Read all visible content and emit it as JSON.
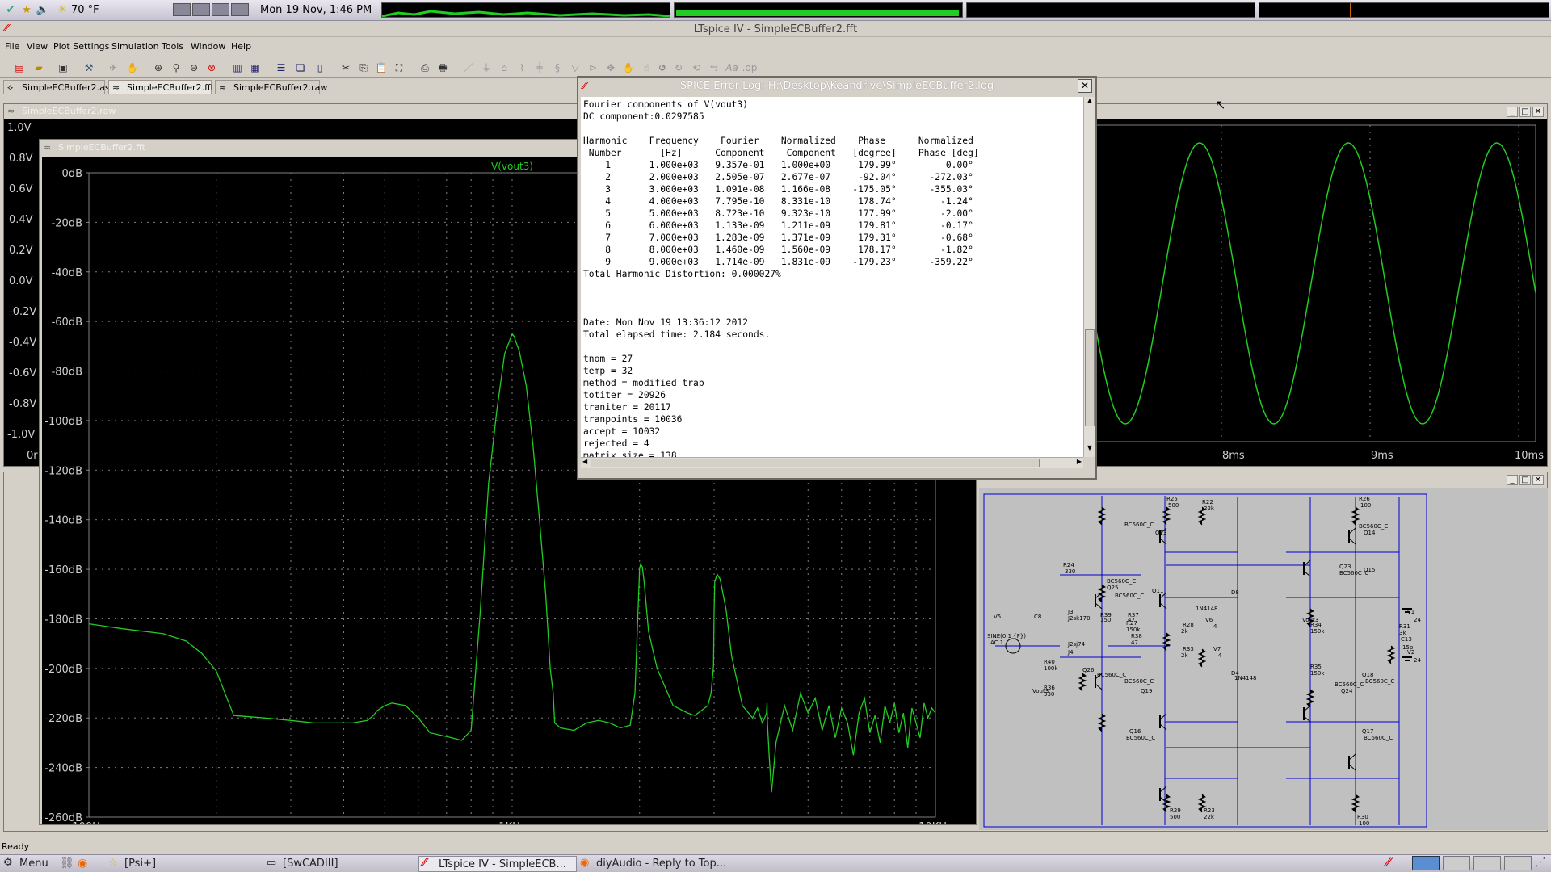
{
  "system_panel": {
    "weather": "70 °F",
    "clock": "Mon 19 Nov,  1:46 PM"
  },
  "window": {
    "title": "LTspice IV - SimpleECBuffer2.fft"
  },
  "menu": [
    "File",
    "View",
    "Plot Settings",
    "Simulation",
    "Tools",
    "Window",
    "Help"
  ],
  "tabs": [
    {
      "label": "SimpleECBuffer2.asc",
      "active": false
    },
    {
      "label": "SimpleECBuffer2.fft",
      "active": true
    },
    {
      "label": "SimpleECBuffer2.raw",
      "active": false
    }
  ],
  "raw_window": {
    "title": "SimpleECBuffer2.raw",
    "y_ticks": [
      "1.0V",
      "0.8V",
      "0.6V",
      "0.4V",
      "0.2V",
      "0.0V",
      "-0.2V",
      "-0.4V",
      "-0.6V",
      "-0.8V",
      "-1.0V"
    ],
    "x_ticks": [
      "8ms",
      "9ms",
      "10ms"
    ],
    "x_partial_label": "0r"
  },
  "fft_window": {
    "title": "SimpleECBuffer2.fft",
    "trace_label": "V(vout3)",
    "colors": {
      "trace": "#22cc22",
      "grid": "#808080",
      "background": "#000000"
    }
  },
  "chart_data": {
    "type": "line",
    "title": "",
    "series": [
      {
        "name": "V(vout3)"
      }
    ],
    "xlabel": "",
    "ylabel": "",
    "x_scale": "log",
    "xlim": [
      100,
      10000
    ],
    "ylim": [
      -260,
      0
    ],
    "y_ticks": [
      "0dB",
      "-20dB",
      "-40dB",
      "-60dB",
      "-80dB",
      "-100dB",
      "-120dB",
      "-140dB",
      "-160dB",
      "-180dB",
      "-200dB",
      "-220dB",
      "-240dB",
      "-260dB"
    ],
    "x_ticks": [
      "100Hz",
      "1KHz",
      "10KHz"
    ],
    "x": [
      100,
      120,
      150,
      170,
      185,
      200,
      220,
      260,
      300,
      340,
      380,
      420,
      455,
      470,
      480,
      500,
      520,
      560,
      600,
      640,
      680,
      720,
      760,
      800,
      840,
      880,
      920,
      960,
      990,
      1000,
      1010,
      1040,
      1080,
      1120,
      1160,
      1200,
      1230,
      1250,
      1260,
      1300,
      1400,
      1500,
      1600,
      1700,
      1800,
      1900,
      1950,
      1970,
      1990,
      2000,
      2010,
      2030,
      2050,
      2100,
      2200,
      2400,
      2600,
      2700,
      2800,
      2900,
      2950,
      2990,
      3000,
      3010,
      3050,
      3100,
      3200,
      3300,
      3500,
      3700,
      3800,
      3900,
      3950,
      3990,
      4000,
      4010,
      4050,
      4100,
      4200,
      4400,
      4600,
      4800,
      5000,
      5200,
      5400,
      5600,
      5800,
      6000,
      6200,
      6400,
      6600,
      6800,
      7000,
      7200,
      7400,
      7600,
      7800,
      8000,
      8200,
      8400,
      8600,
      8800,
      9000,
      9200,
      9400,
      9600,
      9800,
      10000
    ],
    "y": [
      -182,
      -184,
      -186,
      -189,
      -194,
      -201,
      -219,
      -220,
      -221,
      -222,
      -222,
      -222,
      -221,
      -219,
      -217,
      -215,
      -214,
      -215,
      -220,
      -226,
      -227,
      -228,
      -229,
      -225,
      -178,
      -125,
      -96,
      -73,
      -67,
      -65,
      -66,
      -72,
      -86,
      -110,
      -140,
      -170,
      -200,
      -210,
      -222,
      -224,
      -225,
      -222,
      -221,
      -222,
      -224,
      -223,
      -210,
      -190,
      -170,
      -160,
      -158,
      -159,
      -165,
      -185,
      -200,
      -215,
      -218,
      -219,
      -217,
      -215,
      -210,
      -199,
      -177,
      -165,
      -162,
      -164,
      -176,
      -195,
      -215,
      -220,
      -216,
      -222,
      -220,
      -218,
      -214,
      -222,
      -236,
      -250,
      -230,
      -215,
      -225,
      -210,
      -218,
      -212,
      -225,
      -215,
      -228,
      -216,
      -222,
      -235,
      -218,
      -212,
      -226,
      -219,
      -230,
      -215,
      -222,
      -214,
      -226,
      -218,
      -232,
      -216,
      -222,
      -228,
      -214,
      -220,
      -216,
      -218
    ]
  },
  "spice_log": {
    "title": "SPICE Error Log: H:\\Desktop\\Keandrive\\SimpleECBuffer2.log",
    "lines": [
      "Fourier components of V(vout3)",
      "DC component:0.0297585",
      "",
      "Harmonic    Frequency    Fourier    Normalized    Phase      Normalized",
      " Number       [Hz]      Component    Component   [degree]    Phase [deg]",
      "    1       1.000e+03   9.357e-01   1.000e+00     179.99°         0.00°",
      "    2       2.000e+03   2.505e-07   2.677e-07     -92.04°      -272.03°",
      "    3       3.000e+03   1.091e-08   1.166e-08    -175.05°      -355.03°",
      "    4       4.000e+03   7.795e-10   8.331e-10     178.74°        -1.24°",
      "    5       5.000e+03   8.723e-10   9.323e-10     177.99°        -2.00°",
      "    6       6.000e+03   1.133e-09   1.211e-09     179.81°        -0.17°",
      "    7       7.000e+03   1.283e-09   1.371e-09     179.31°        -0.68°",
      "    8       8.000e+03   1.460e-09   1.560e-09     178.17°        -1.82°",
      "    9       9.000e+03   1.714e-09   1.831e-09    -179.23°      -359.22°",
      "Total Harmonic Distortion: 0.000027%",
      "",
      "",
      "",
      "Date: Mon Nov 19 13:36:12 2012",
      "Total elapsed time: 2.184 seconds.",
      "",
      "tnom = 27",
      "temp = 32",
      "method = modified trap",
      "totiter = 20926",
      "traniter = 20117",
      "tranpoints = 10036",
      "accept = 10032",
      "rejected = 4",
      "matrix size = 138"
    ]
  },
  "schematic": {
    "labels": [
      "R25",
      "500",
      "R22",
      "22k",
      "R26",
      "100",
      "BC560C_C",
      "Q13",
      "BC560C_C",
      "Q14",
      "R24",
      "330",
      "BC560C_C",
      "Q25",
      "Q23",
      "BC560C_C",
      "Q11",
      "BC560C_C",
      "D8",
      "Q15",
      "J3",
      "J2sk170",
      "R39",
      "150",
      "R37",
      "47",
      "R27",
      "150k",
      "R28",
      "2k",
      "R34",
      "150k",
      "V5",
      "SINE(0 1 {F})",
      "AC 1",
      "C8",
      "R38",
      "47",
      "1N4148",
      "V6",
      "4",
      "V7",
      "4",
      "J2sj74",
      "J4",
      "R33",
      "2k",
      "Vout3",
      "R31",
      "3k",
      "C13",
      "15p",
      "V1",
      "24",
      "V2",
      "24",
      "R40",
      "100k",
      "Q26",
      "BC560C_C",
      "D4",
      "1N4148",
      "R35",
      "150k",
      "Q18",
      "BC560C_C",
      "R36",
      "330",
      "Vout3",
      "BC560C_C",
      "Q19",
      "BC560C_C",
      "Q24",
      "Q16",
      "BC560C_C",
      "Q17",
      "BC560C_C",
      "R29",
      "500",
      "R23",
      "22k",
      "R30",
      "100"
    ]
  },
  "status": {
    "text": "Ready"
  },
  "taskbar": {
    "menu": "Menu",
    "tasks": [
      "[Psi+]",
      "[SwCADIII]",
      "LTspice IV - SimpleECB...",
      "diyAudio - Reply to Top..."
    ]
  }
}
